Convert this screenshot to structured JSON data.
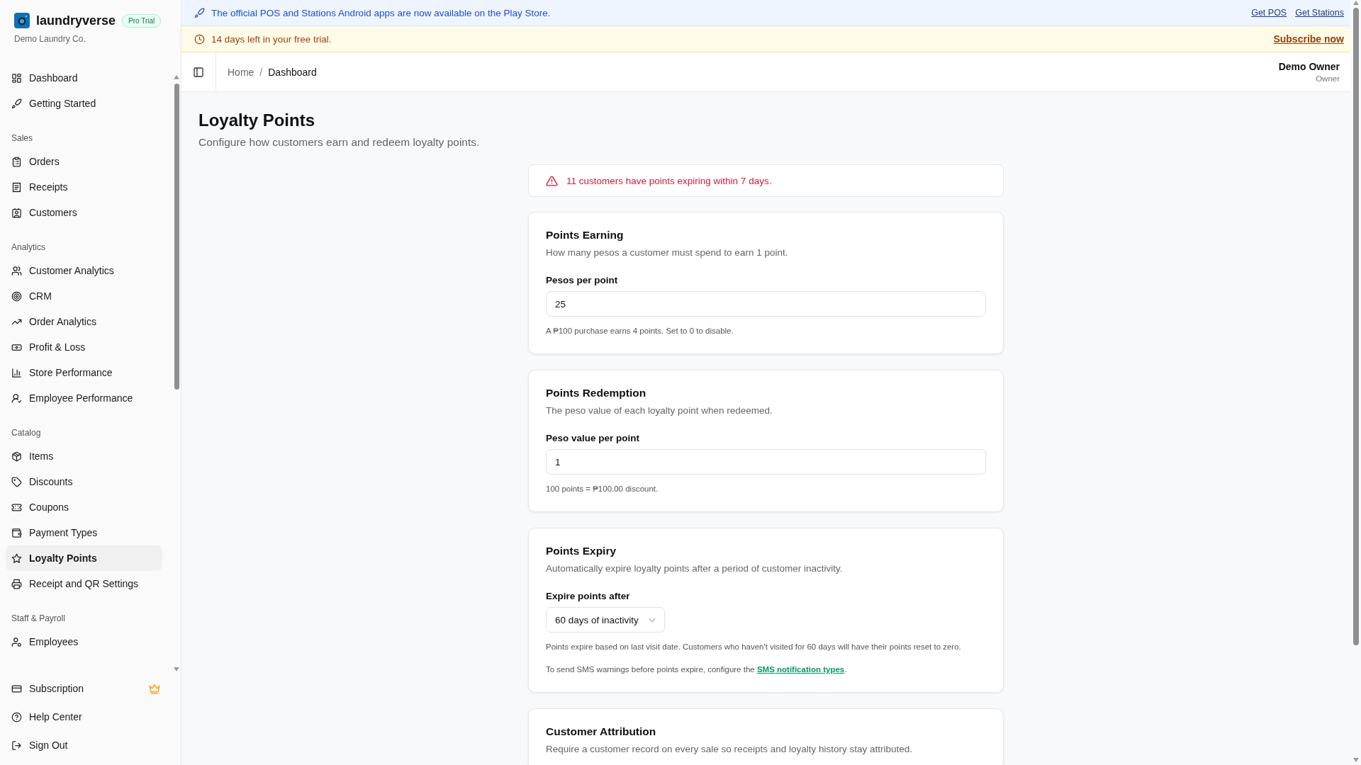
{
  "sidebar": {
    "brand": {
      "name": "laundryverse",
      "badge": "Pro Trial",
      "org": "Demo Laundry Co."
    },
    "groups": [
      {
        "items": [
          {
            "label": "Dashboard",
            "selected": false
          },
          {
            "label": "Getting Started",
            "selected": false
          }
        ]
      },
      {
        "heading": "Sales",
        "items": [
          {
            "label": "Orders",
            "selected": false
          },
          {
            "label": "Receipts",
            "selected": false
          },
          {
            "label": "Customers",
            "selected": false
          }
        ]
      },
      {
        "heading": "Analytics",
        "items": [
          {
            "label": "Customer Analytics",
            "selected": false
          },
          {
            "label": "CRM",
            "selected": false
          },
          {
            "label": "Order Analytics",
            "selected": false
          },
          {
            "label": "Profit & Loss",
            "selected": false
          },
          {
            "label": "Store Performance",
            "selected": false
          },
          {
            "label": "Employee Performance",
            "selected": false
          }
        ]
      },
      {
        "heading": "Catalog",
        "items": [
          {
            "label": "Items",
            "selected": false
          },
          {
            "label": "Discounts",
            "selected": false
          },
          {
            "label": "Coupons",
            "selected": false
          },
          {
            "label": "Payment Types",
            "selected": false
          },
          {
            "label": "Loyalty Points",
            "selected": true
          },
          {
            "label": "Receipt and QR Settings",
            "selected": false
          }
        ]
      },
      {
        "heading": "Staff & Payroll",
        "items": [
          {
            "label": "Employees",
            "selected": false
          }
        ]
      }
    ],
    "footer": [
      {
        "label": "Subscription"
      },
      {
        "label": "Help Center"
      },
      {
        "label": "Sign Out"
      }
    ]
  },
  "banners": [
    {
      "kind": "info",
      "text": "The official POS and Stations Android apps are now available on the Play Store.",
      "links": [
        "Get POS",
        "Get Stations"
      ]
    },
    {
      "kind": "warning",
      "text": "14 days left in your free trial.",
      "links": [
        "Subscribe now"
      ]
    }
  ],
  "header": {
    "separator": "/",
    "breadcrumb": [
      {
        "label": "Home",
        "current": false
      },
      {
        "label": "Dashboard",
        "current": true
      }
    ],
    "user": {
      "name": "Demo Owner",
      "role": "Owner"
    }
  },
  "page": {
    "title": "Loyalty Points",
    "subtitle": "Configure how customers earn and redeem loyalty points.",
    "alert": "11 customers have points expiring within 7 days.",
    "cards": [
      {
        "title": "Points Earning",
        "description": "How many pesos a customer must spend to earn 1 point.",
        "field": {
          "kind": "input",
          "label": "Pesos per point",
          "value": "25"
        },
        "notes": [
          {
            "text": "A ₱100 purchase earns 4 points. Set to 0 to disable."
          }
        ]
      },
      {
        "title": "Points Redemption",
        "description": "The peso value of each loyalty point when redeemed.",
        "field": {
          "kind": "input",
          "label": "Peso value per point",
          "value": "1"
        },
        "notes": [
          {
            "text": "100 points = ₱100.00 discount."
          }
        ]
      },
      {
        "title": "Points Expiry",
        "description": "Automatically expire loyalty points after a period of customer inactivity.",
        "field": {
          "kind": "select",
          "label": "Expire points after",
          "value": "60 days of inactivity"
        },
        "notes": [
          {
            "text": "Points expire based on last visit date. Customers who haven't visited for 60 days will have their points reset to zero."
          },
          {
            "text": "To send SMS warnings before points expire, configure the ",
            "link": "SMS notification types",
            "after": "."
          }
        ]
      },
      {
        "title": "Customer Attribution",
        "description": "Require a customer record on every sale so receipts and loyalty history stay attributed."
      }
    ]
  }
}
